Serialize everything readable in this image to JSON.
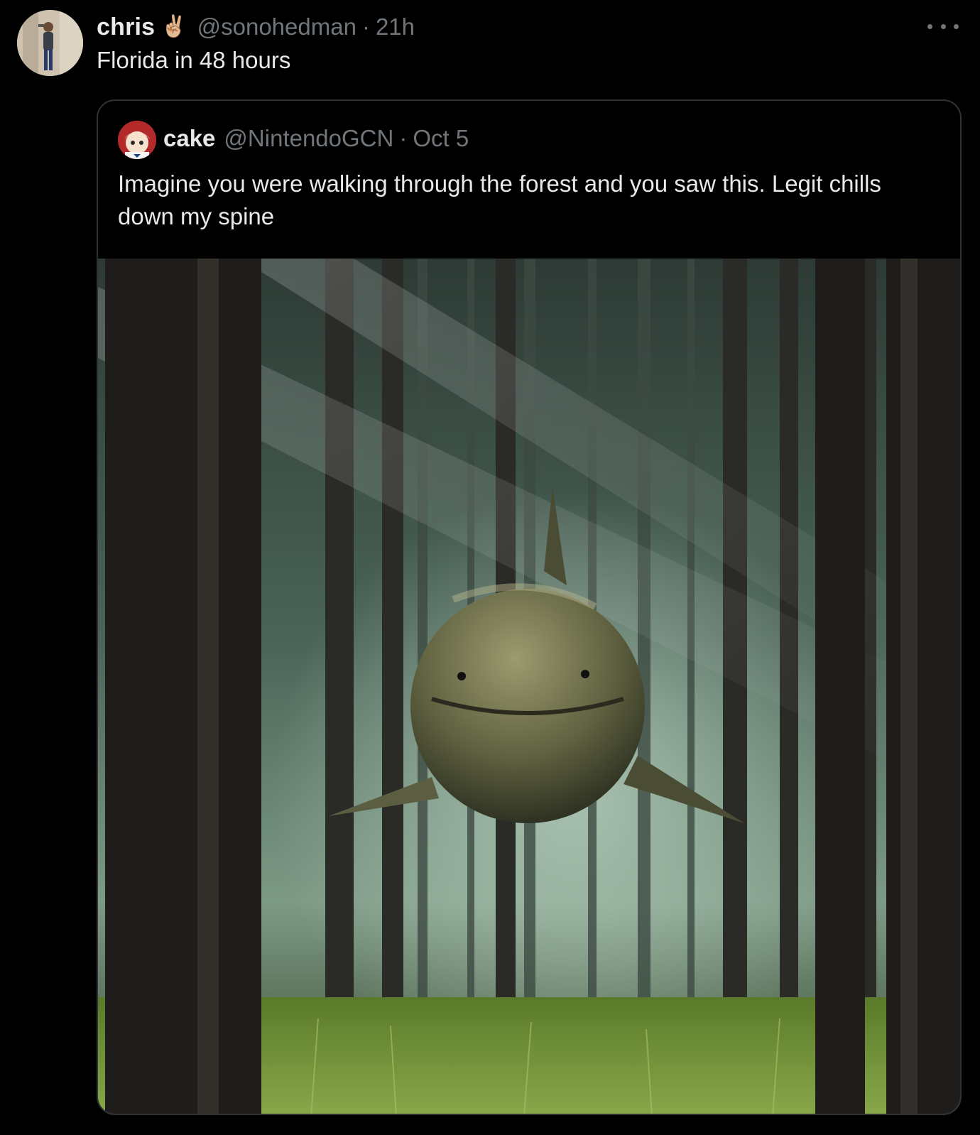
{
  "tweet": {
    "display_name": "chris",
    "emoji": "✌🏼",
    "handle": "@sonohedman",
    "separator": "·",
    "time": "21h",
    "text": "Florida in 48 hours",
    "avatar_icon": "user-avatar-photo",
    "more_icon": "more-options-icon"
  },
  "quoted_tweet": {
    "display_name": "cake",
    "handle": "@NintendoGCN",
    "separator": "·",
    "time": "Oct 5",
    "text": "Imagine you were walking through the forest and you saw this. Legit chills down my spine",
    "avatar_icon": "anime-character-avatar",
    "media": {
      "description_icon": "shark-in-forest-image"
    }
  },
  "colors": {
    "background": "#000000",
    "primary_text": "#e7e9ea",
    "secondary_text": "#71767b",
    "border": "#2f3336"
  }
}
